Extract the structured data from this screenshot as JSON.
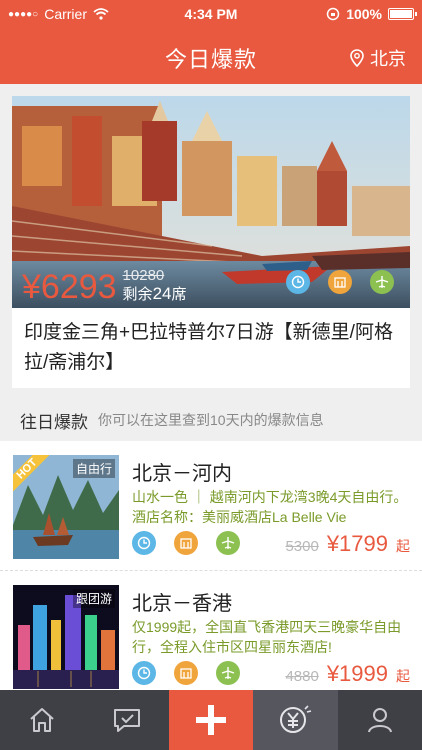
{
  "status_bar": {
    "carrier": "Carrier",
    "time": "4:34 PM",
    "battery": "100%"
  },
  "header": {
    "title": "今日爆款",
    "location": "北京"
  },
  "featured": {
    "price": "¥6293",
    "original_price": "10280",
    "remaining_prefix": "剩余",
    "remaining_count": "24",
    "remaining_suffix": "席",
    "title": "印度金三角+巴拉特普尔7日游【新德里/阿格拉/斋浦尔】"
  },
  "section": {
    "title": "往日爆款",
    "subtitle": "你可以在这里查到10天内的爆款信息"
  },
  "items": [
    {
      "tag": "自由行",
      "hot": "HOT",
      "title": "北京－河内",
      "desc": "山水一色 ｜ 越南河内下龙湾3晚4天自由行。酒店名称：美丽威酒店La Belle Vie",
      "old_price": "5300",
      "price": "¥1799",
      "unit": "起"
    },
    {
      "tag": "跟团游",
      "title": "北京－香港",
      "desc": "仅1999起，全国直飞香港四天三晚豪华自由行，全程入住市区四星丽东酒店!",
      "old_price": "4880",
      "price": "¥1999",
      "unit": "起"
    }
  ],
  "tabbar": {
    "icons": [
      "home-icon",
      "message-icon",
      "plus-icon",
      "yuan-bell-icon",
      "user-icon"
    ]
  },
  "colors": {
    "accent": "#e8593f",
    "tabbar": "#3f3f46"
  }
}
